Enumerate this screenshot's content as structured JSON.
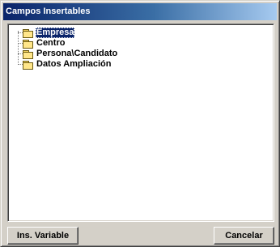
{
  "window": {
    "title": "Campos Insertables"
  },
  "tree": {
    "items": [
      {
        "label": "Empresa",
        "icon": "folder-icon",
        "selected": true
      },
      {
        "label": "Centro",
        "icon": "folder-icon",
        "selected": false
      },
      {
        "label": "Persona\\Candidato",
        "icon": "folder-icon",
        "selected": false
      },
      {
        "label": "Datos Ampliación",
        "icon": "folder-icon",
        "selected": false
      }
    ]
  },
  "buttons": {
    "ins_variable": "Ins. Variable",
    "cancelar": "Cancelar"
  },
  "colors": {
    "title_start": "#0a246a",
    "title_end": "#a6caf0",
    "face": "#d4d0c8",
    "selection": "#0a246a",
    "folder": "#ffe68a"
  }
}
